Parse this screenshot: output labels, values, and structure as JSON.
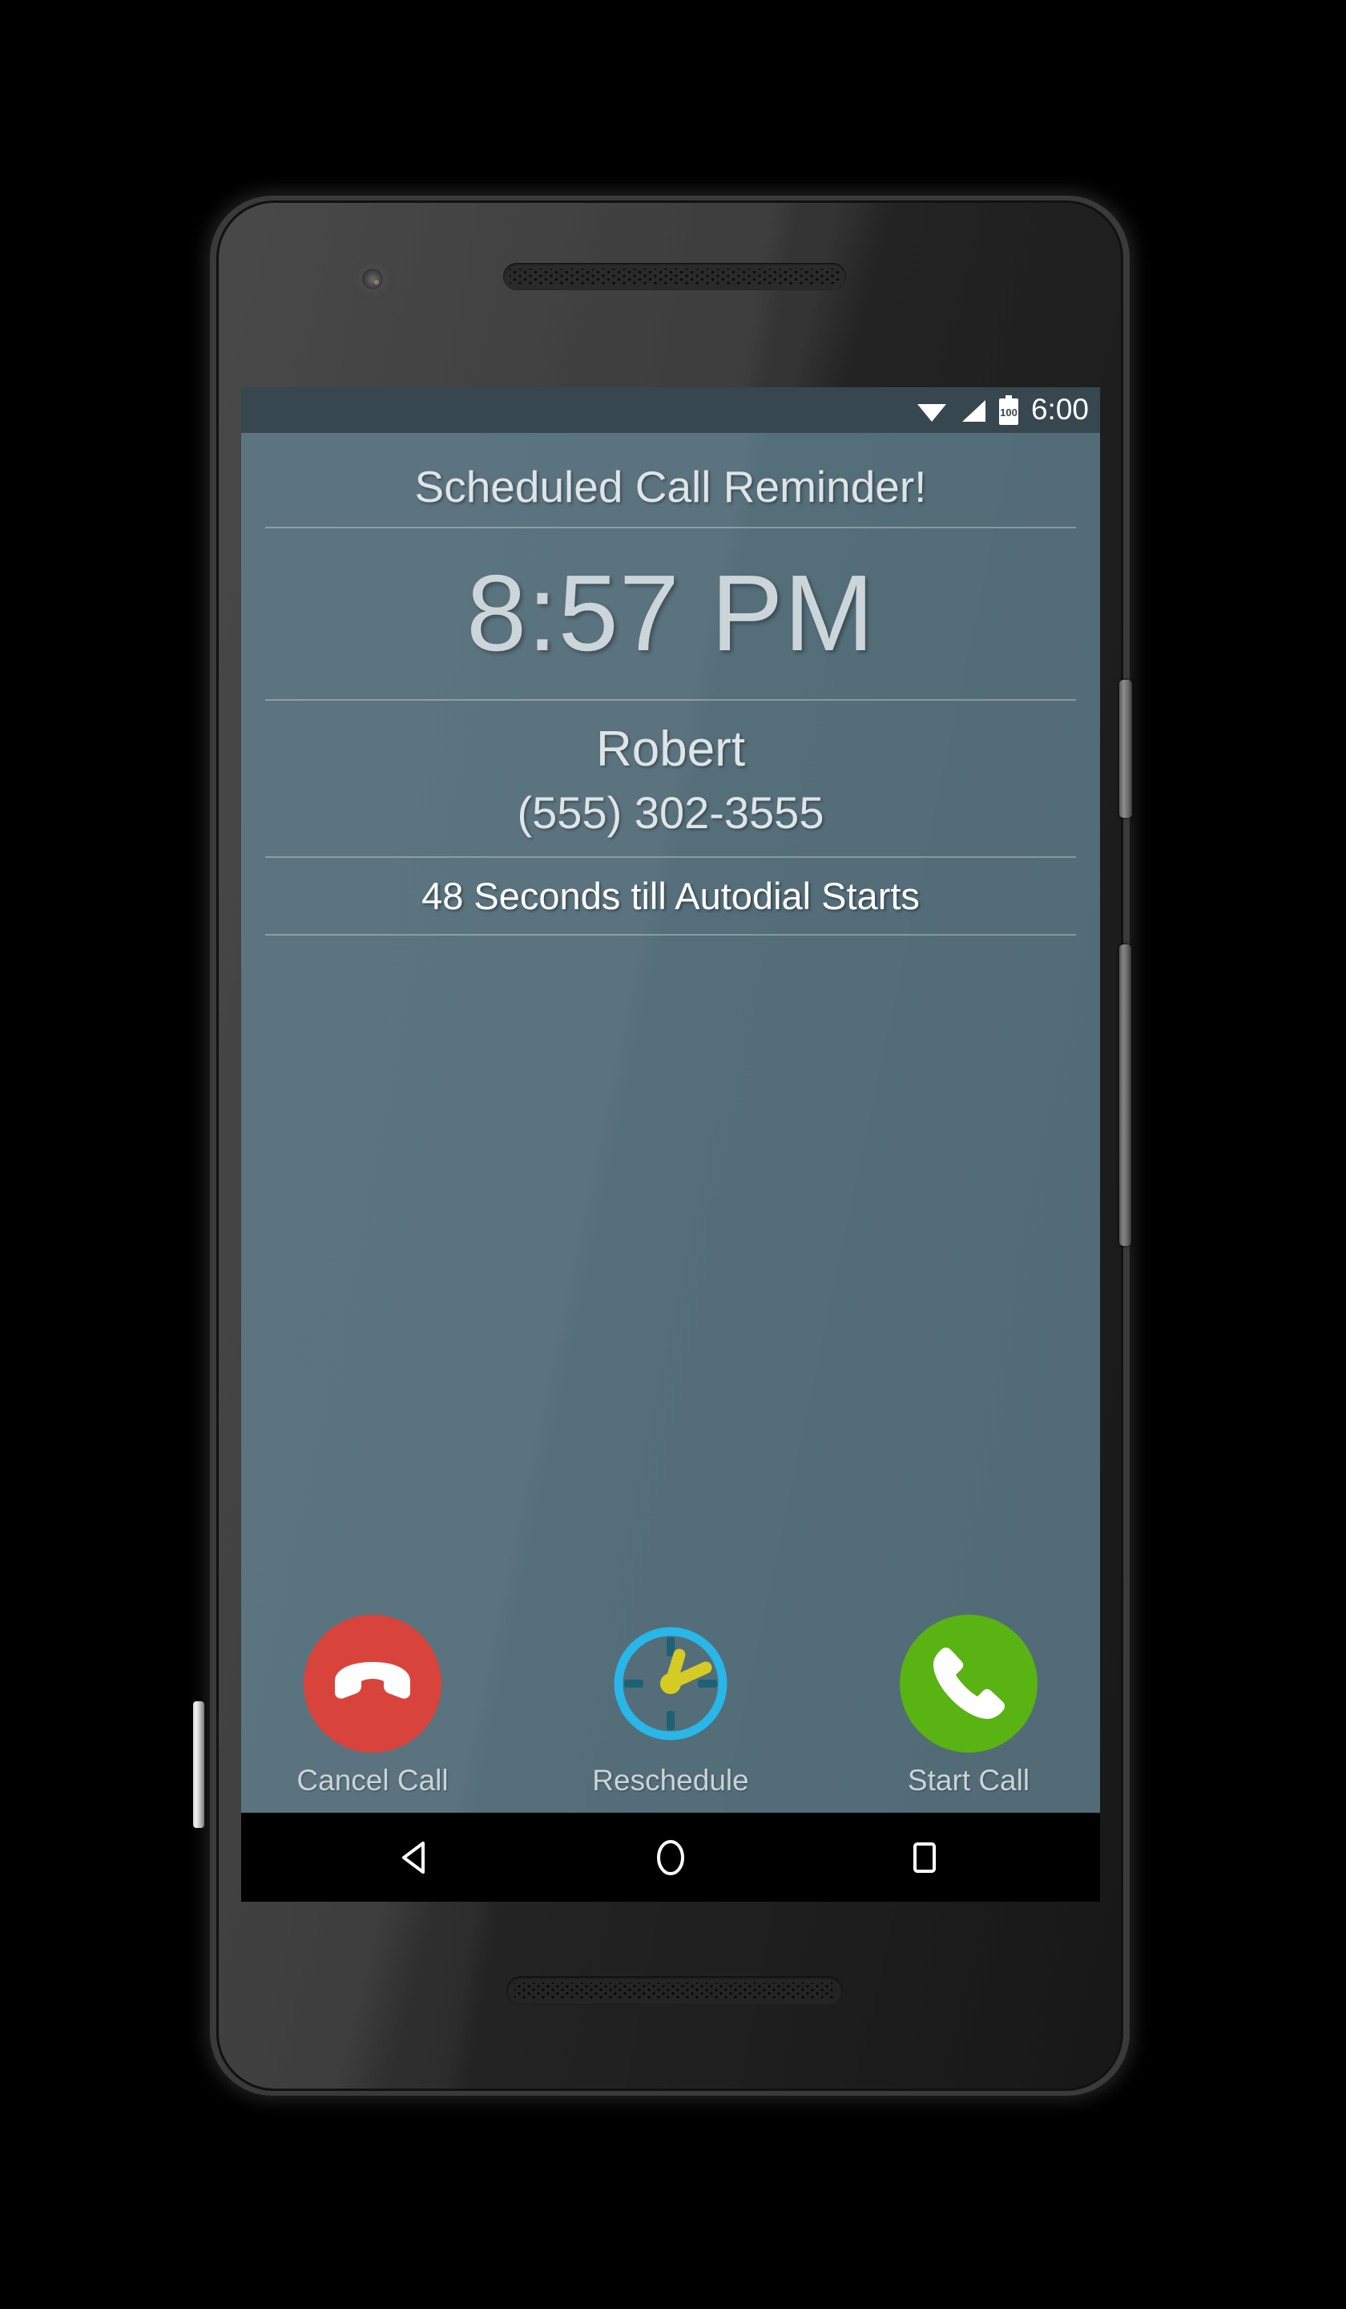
{
  "device": {
    "frame": "android-phone",
    "elements": {
      "front_camera": "front-camera-icon",
      "earpiece": "earpiece-speaker",
      "bottom_speaker": "bottom-speaker",
      "power_button": "power-button",
      "volume_button": "volume-button"
    }
  },
  "status_bar": {
    "time": "6:00",
    "battery_level": "100",
    "icons": [
      "wifi-icon",
      "signal-icon",
      "battery-icon"
    ],
    "background": "#37474f"
  },
  "screen": {
    "background": "#546e7a",
    "title": "Scheduled Call Reminder!",
    "scheduled_time": "8:57 PM",
    "contact_name": "Robert",
    "contact_phone": "(555) 302-3555",
    "countdown": "48 Seconds till Autodial Starts"
  },
  "actions": [
    {
      "id": "cancel-call",
      "label": "Cancel Call",
      "icon": "end-call-icon",
      "color": "#d8443c"
    },
    {
      "id": "reschedule",
      "label": "Reschedule",
      "icon": "clock-icon",
      "color": "#29b6e8",
      "hands_color": "#d6cb25"
    },
    {
      "id": "start-call",
      "label": "Start Call",
      "icon": "phone-handset-icon",
      "color": "#59b312"
    }
  ],
  "nav_bar": {
    "buttons": [
      {
        "id": "back",
        "icon": "back-triangle-icon"
      },
      {
        "id": "home",
        "icon": "home-circle-icon"
      },
      {
        "id": "recents",
        "icon": "recents-square-icon"
      }
    ]
  }
}
